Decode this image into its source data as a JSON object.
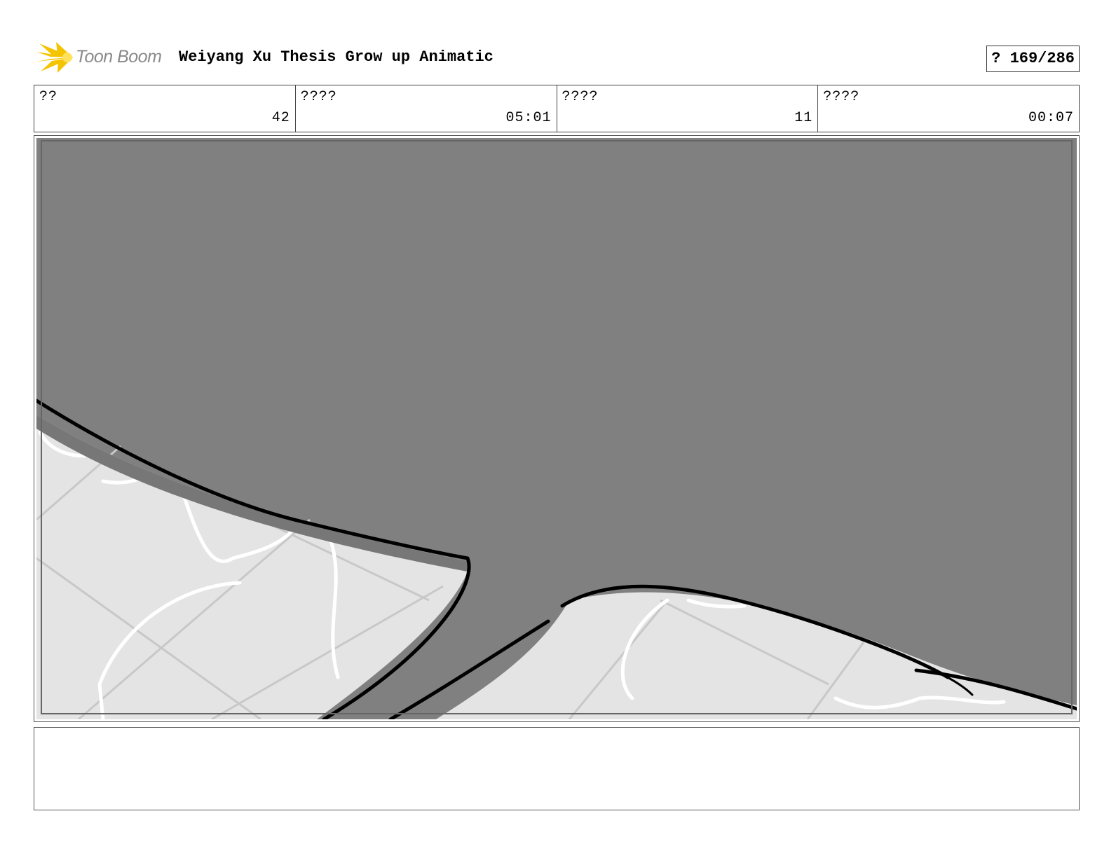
{
  "header": {
    "logo_text": "Toon Boom",
    "logo_icon": "toon-boom-starburst-icon",
    "title": "Weiyang Xu Thesis Grow up Animatic",
    "page_label": "? 169/286"
  },
  "info": [
    {
      "label": "??",
      "value": "42"
    },
    {
      "label": "????",
      "value": "05:01"
    },
    {
      "label": "????",
      "value": "11"
    },
    {
      "label": "????",
      "value": "00:07"
    }
  ],
  "panel": {
    "background_color": "#808080",
    "floor_color": "#e4e4e4",
    "line_color": "#000000"
  },
  "notes": {
    "text": ""
  }
}
